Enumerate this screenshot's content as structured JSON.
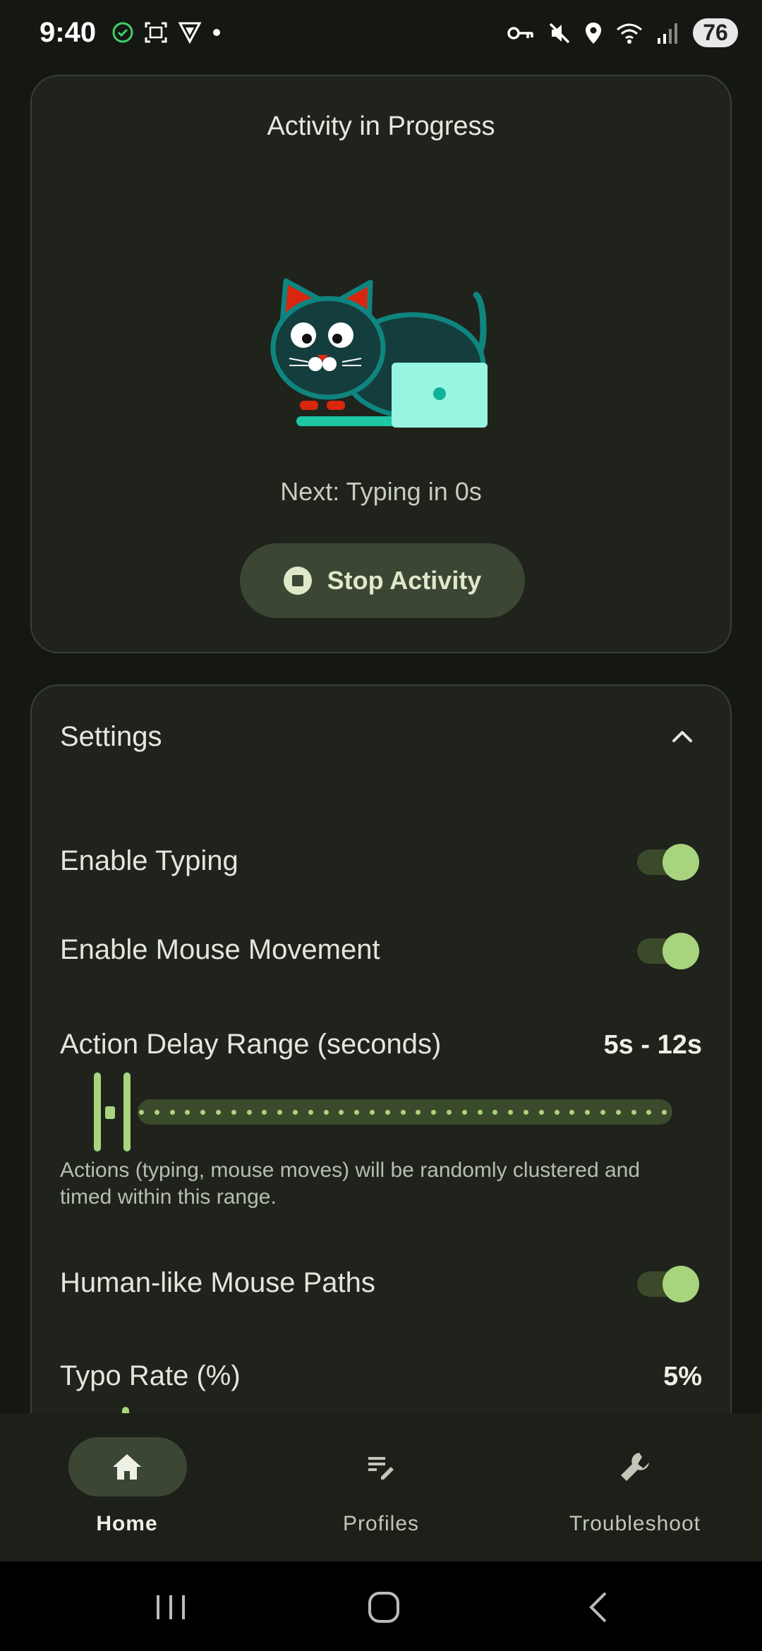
{
  "status_bar": {
    "time": "9:40",
    "battery": "76",
    "icons_left": [
      "check-circle-icon",
      "screenshot-icon",
      "vpn-shield-icon",
      "dot-icon"
    ],
    "icons_right": [
      "key-icon",
      "mute-icon",
      "location-icon",
      "wifi-icon",
      "signal-icon",
      "battery-icon"
    ]
  },
  "activity": {
    "title": "Activity in Progress",
    "next_text": "Next: Typing in 0s",
    "stop_label": "Stop Activity"
  },
  "settings": {
    "title": "Settings",
    "enable_typing": {
      "label": "Enable Typing",
      "on": true
    },
    "enable_mouse": {
      "label": "Enable Mouse Movement",
      "on": true
    },
    "delay_range": {
      "label": "Action Delay Range (seconds)",
      "value": "5s - 12s",
      "min": 5,
      "max": 12,
      "helper": "Actions (typing, mouse moves) will be randomly clustered and timed within this range."
    },
    "human_paths": {
      "label": "Human-like Mouse Paths",
      "on": true
    },
    "typo_rate": {
      "label": "Typo Rate (%)",
      "value": "5%"
    }
  },
  "bottom_nav": {
    "items": [
      {
        "label": "Home",
        "icon": "home-icon",
        "active": true
      },
      {
        "label": "Profiles",
        "icon": "edit-list-icon",
        "active": false
      },
      {
        "label": "Troubleshoot",
        "icon": "wrench-icon",
        "active": false
      }
    ]
  },
  "colors": {
    "background": "#151812",
    "card": "#1f231c",
    "accent": "#a9d47e",
    "accent_container": "#3b4634"
  }
}
